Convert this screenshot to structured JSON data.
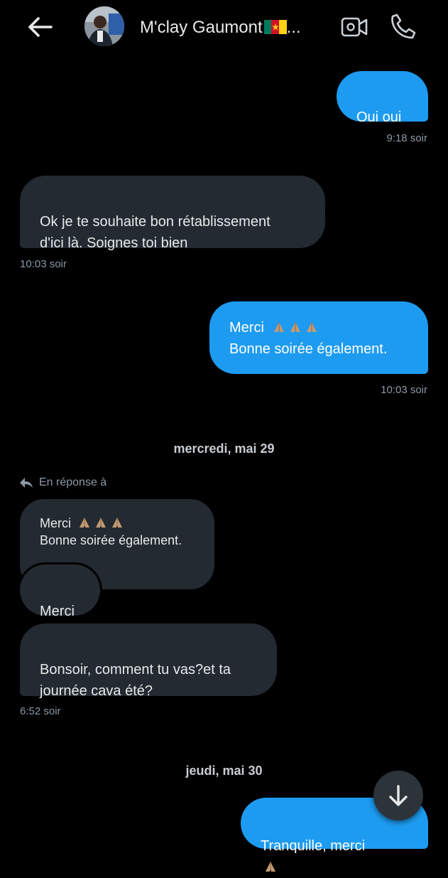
{
  "header": {
    "contact_name": "M'clay Gaumont",
    "ellipsis": "...",
    "flag_colors": [
      "#007a5e",
      "#ce1126",
      "#fcd116"
    ]
  },
  "icons": {
    "back": "back-arrow-icon",
    "video": "video-camera-icon",
    "call": "phone-icon",
    "reply": "reply-arrow-icon",
    "scroll_down": "arrow-down-icon",
    "emoji": "folded-hands-emoji"
  },
  "colors": {
    "sent_bubble": "#1d9bf0",
    "received_bubble": "#232a31",
    "background": "#000000",
    "timestamp": "#8b98a5"
  },
  "messages": [
    {
      "id": "m1",
      "direction": "sent",
      "text": "Oui oui",
      "time": "9:18 soir"
    },
    {
      "id": "m2",
      "direction": "received",
      "text": "Ok je te souhaite bon rétablissement\nd'ici là. Soignes toi bien",
      "time": "10:03 soir"
    },
    {
      "id": "m3",
      "direction": "sent",
      "line1": "Merci",
      "line2": "Bonne soirée également.",
      "emoji_count": 3,
      "time": "10:03 soir"
    },
    {
      "id": "m4",
      "direction": "received",
      "reply_label": "En réponse à",
      "quoted_line1": "Merci",
      "quoted_line2": "Bonne soirée également.",
      "text": "Merci"
    },
    {
      "id": "m5",
      "direction": "received",
      "text": "Bonsoir, comment tu vas?et ta\njournée cava été?",
      "time": "6:52 soir"
    },
    {
      "id": "m6",
      "direction": "sent",
      "text": "Tranquille,  merci"
    }
  ],
  "date_separators": [
    "mercredi, mai 29",
    "jeudi, mai 30"
  ]
}
